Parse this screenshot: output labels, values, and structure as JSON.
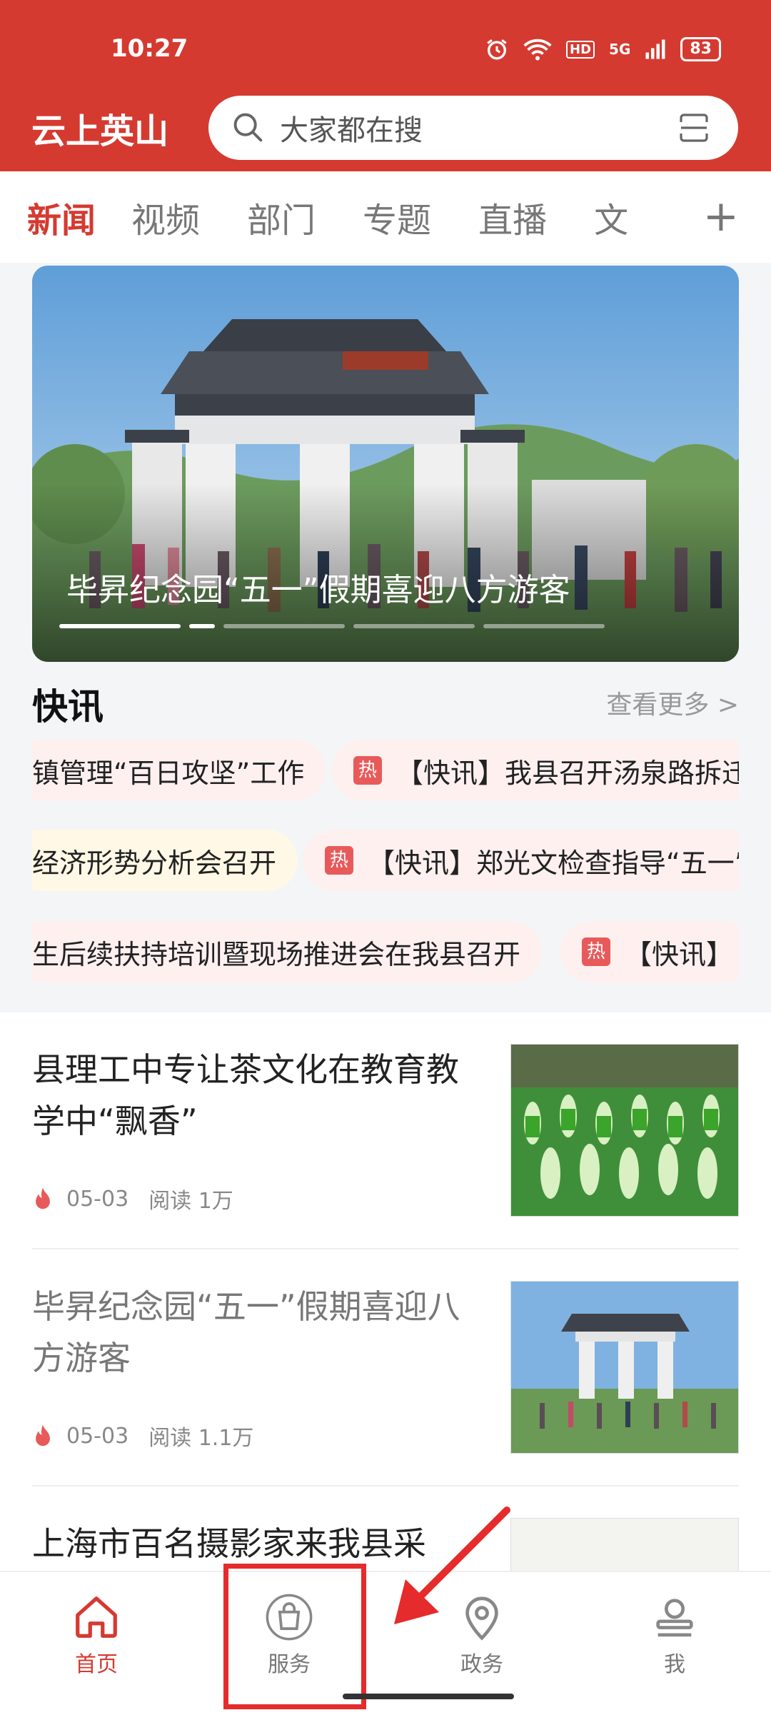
{
  "status": {
    "time": "10:27",
    "battery": "83",
    "hd": "HD",
    "network": "5G"
  },
  "header": {
    "brand": "云上英山",
    "search_placeholder": "大家都在搜"
  },
  "tabs": [
    {
      "label": "新闻",
      "active": true
    },
    {
      "label": "视频"
    },
    {
      "label": "部门"
    },
    {
      "label": "专题"
    },
    {
      "label": "直播"
    },
    {
      "label": "文"
    }
  ],
  "banner": {
    "title": "毕昇纪念园“五一”假期喜迎八方游客",
    "slides": 5,
    "active_slide": 1
  },
  "kuaixun": {
    "title": "快讯",
    "more": "查看更多 >",
    "rows": [
      [
        {
          "text": "镇管理“百日攻坚”工作",
          "hot": false
        },
        {
          "text": "【快讯】我县召开汤泉路拆迁",
          "hot": true,
          "badge": "热"
        }
      ],
      [
        {
          "text": "经济形势分析会召开",
          "hot": false
        },
        {
          "text": "【快讯】郑光文检查指导“五一”",
          "hot": true,
          "badge": "热"
        }
      ],
      [
        {
          "text": "生后续扶持培训暨现场推进会在我县召开",
          "hot": false
        },
        {
          "text": "【快讯】",
          "hot": true,
          "badge": "热"
        }
      ]
    ]
  },
  "news": [
    {
      "title": "县理工中专让茶文化在教育教学中“飘香”",
      "date": "05-03",
      "reads": "阅读 1万",
      "read": false
    },
    {
      "title": "毕昇纪念园“五一”假期喜迎八方游客",
      "date": "05-03",
      "reads": "阅读 1.1万",
      "read": true
    },
    {
      "title": "上海市百名摄影家来我县采",
      "date": "",
      "reads": "",
      "read": false
    }
  ],
  "tabbar": [
    {
      "label": "首页",
      "icon": "home-icon",
      "active": true
    },
    {
      "label": "服务",
      "icon": "shopping-bag-icon"
    },
    {
      "label": "政务",
      "icon": "location-pin-icon"
    },
    {
      "label": "我",
      "icon": "user-icon"
    }
  ],
  "colors": {
    "brand": "#d53a30",
    "annotation": "#e52b2b"
  }
}
